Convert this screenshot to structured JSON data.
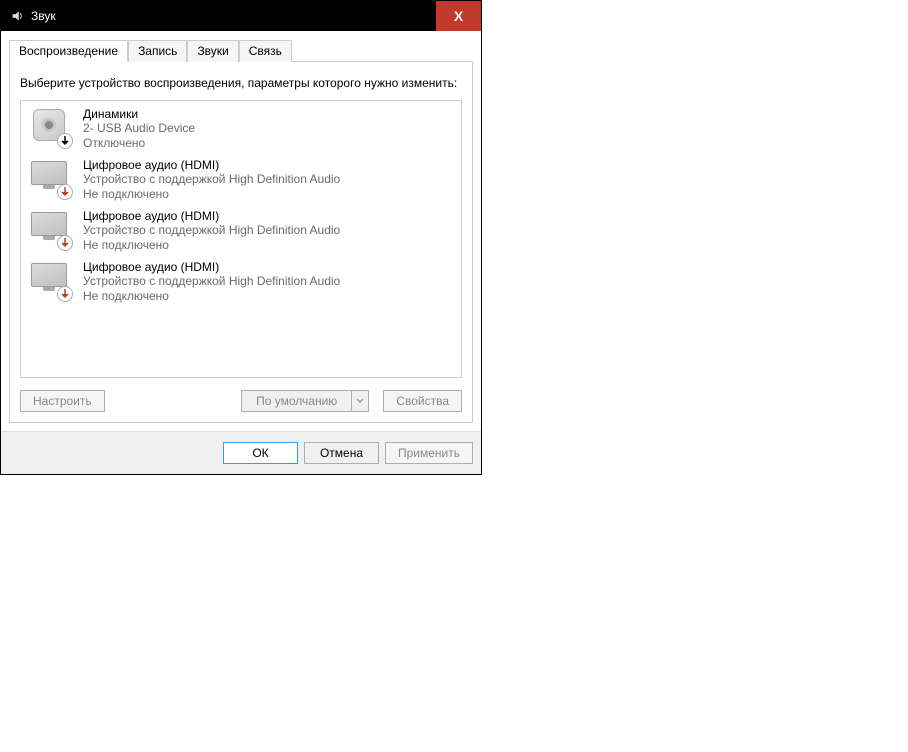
{
  "window": {
    "title": "Звук",
    "close_label": "X"
  },
  "tabs": [
    {
      "label": "Воспроизведение",
      "active": true
    },
    {
      "label": "Запись",
      "active": false
    },
    {
      "label": "Звуки",
      "active": false
    },
    {
      "label": "Связь",
      "active": false
    }
  ],
  "instruction": "Выберите устройство воспроизведения, параметры которого нужно изменить:",
  "devices": [
    {
      "name": "Динамики",
      "desc": "2- USB Audio Device",
      "status": "Отключено",
      "icon": "speaker",
      "badge": "down-black"
    },
    {
      "name": "Цифровое аудио (HDMI)",
      "desc": "Устройство с поддержкой High Definition Audio",
      "status": "Не подключено",
      "icon": "monitor",
      "badge": "down-red"
    },
    {
      "name": "Цифровое аудио (HDMI)",
      "desc": "Устройство с поддержкой High Definition Audio",
      "status": "Не подключено",
      "icon": "monitor",
      "badge": "down-red"
    },
    {
      "name": "Цифровое аудио (HDMI)",
      "desc": "Устройство с поддержкой High Definition Audio",
      "status": "Не подключено",
      "icon": "monitor",
      "badge": "down-red"
    }
  ],
  "buttons": {
    "configure": "Настроить",
    "default": "По умолчанию",
    "properties": "Свойства",
    "ok": "ОК",
    "cancel": "Отмена",
    "apply": "Применить"
  }
}
